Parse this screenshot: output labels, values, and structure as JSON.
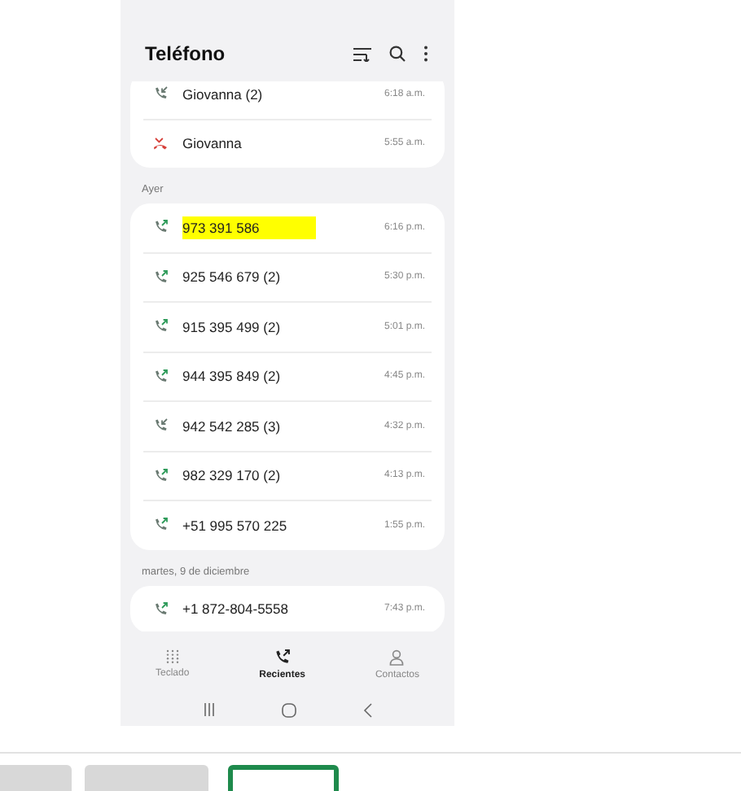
{
  "app_bar": {
    "title": "Teléfono"
  },
  "sections": [
    {
      "calls": [
        {
          "name": "Giovanna (2)",
          "time": "6:18 a.m.",
          "kind": "incoming",
          "highlighted": false
        },
        {
          "name": "Giovanna",
          "time": "5:55 a.m.",
          "kind": "missed",
          "highlighted": false
        }
      ]
    },
    {
      "header": "Ayer",
      "calls": [
        {
          "name": "973 391 586",
          "time": "6:16 p.m.",
          "kind": "outgoing",
          "highlighted": true
        },
        {
          "name": "925 546 679 (2)",
          "time": "5:30 p.m.",
          "kind": "outgoing",
          "highlighted": false
        },
        {
          "name": "915 395 499 (2)",
          "time": "5:01 p.m.",
          "kind": "outgoing",
          "highlighted": false
        },
        {
          "name": "944 395 849 (2)",
          "time": "4:45 p.m.",
          "kind": "outgoing",
          "highlighted": false
        },
        {
          "name": "942 542 285 (3)",
          "time": "4:32 p.m.",
          "kind": "incoming",
          "highlighted": false
        },
        {
          "name": "982 329 170 (2)",
          "time": "4:13 p.m.",
          "kind": "outgoing",
          "highlighted": false
        },
        {
          "name": "+51 995 570 225",
          "time": "1:55 p.m.",
          "kind": "outgoing",
          "highlighted": false
        }
      ]
    },
    {
      "header": "martes, 9 de diciembre",
      "calls": [
        {
          "name": "+1 872-804-5558",
          "time": "7:43 p.m.",
          "kind": "outgoing",
          "highlighted": false
        }
      ]
    }
  ],
  "bottom_nav": [
    {
      "label": "Teclado",
      "kind": "keypad",
      "selected": false
    },
    {
      "label": "Recientes",
      "kind": "recents",
      "selected": true
    },
    {
      "label": "Contactos",
      "kind": "contacts",
      "selected": false
    }
  ],
  "thumbnails": [
    {
      "selected": false
    },
    {
      "selected": false
    },
    {
      "selected": true
    }
  ]
}
